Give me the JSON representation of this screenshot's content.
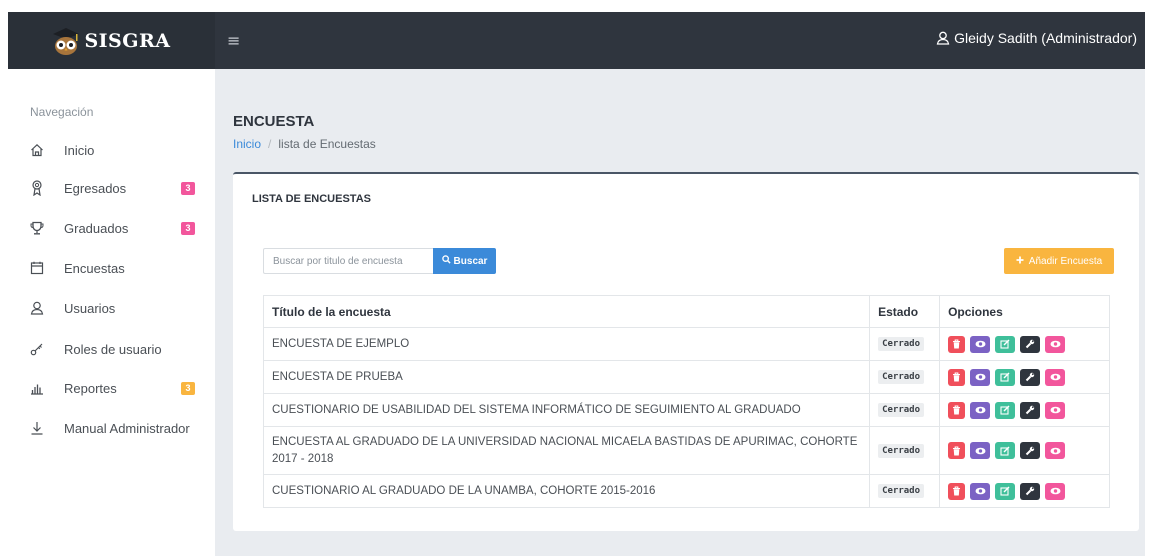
{
  "app": {
    "brand": "SISGRA",
    "menu_toggle": "≡",
    "user": "Gleidy Sadith (Administrador)"
  },
  "sidebar": {
    "title": "Navegación",
    "items": [
      {
        "label": "Inicio",
        "icon": "home-icon"
      },
      {
        "label": "Egresados",
        "icon": "badge-icon",
        "badge": "3"
      },
      {
        "label": "Graduados",
        "icon": "trophy-icon",
        "badge": "3"
      },
      {
        "label": "Encuestas",
        "icon": "calendar-icon"
      },
      {
        "label": "Usuarios",
        "icon": "user-icon"
      },
      {
        "label": "Roles de usuario",
        "icon": "key-icon"
      },
      {
        "label": "Reportes",
        "icon": "bar-chart-icon",
        "badge": "3"
      },
      {
        "label": "Manual Administrador",
        "icon": "download-icon"
      }
    ]
  },
  "colors": {
    "topbar": "#2f353e",
    "primary": "#3b8ad9",
    "warning": "#f9b53f",
    "badge_pink": "#f2569c",
    "badge_orange": "#f9b53f"
  },
  "page": {
    "title": "ENCUESTA",
    "breadcrumb": {
      "home": "Inicio",
      "separator": "/",
      "current": "lista de Encuestas"
    }
  },
  "card": {
    "title": "LISTA DE ENCUESTAS",
    "search_placeholder": "Buscar por titulo de encuesta",
    "search_button": "Buscar",
    "add_button": "Añadir Encuesta"
  },
  "table": {
    "headers": {
      "title": "Título de la encuesta",
      "state": "Estado",
      "options": "Opciones"
    },
    "rows": [
      {
        "title": "ENCUESTA DE EJEMPLO",
        "state": "Cerrado"
      },
      {
        "title": "ENCUESTA DE PRUEBA",
        "state": "Cerrado"
      },
      {
        "title": "CUESTIONARIO DE USABILIDAD DEL SISTEMA INFORMÁTICO DE SEGUIMIENTO AL GRADUADO",
        "state": "Cerrado"
      },
      {
        "title": "ENCUESTA AL GRADUADO DE LA UNIVERSIDAD NACIONAL MICAELA BASTIDAS DE APURIMAC, COHORTE 2017 - 2018",
        "state": "Cerrado"
      },
      {
        "title": "CUESTIONARIO AL GRADUADO DE LA UNAMBA, COHORTE 2015-2016",
        "state": "Cerrado"
      }
    ],
    "option_icons": [
      "trash-icon",
      "eye-icon",
      "edit-icon",
      "wrench-icon",
      "eye-icon"
    ]
  }
}
